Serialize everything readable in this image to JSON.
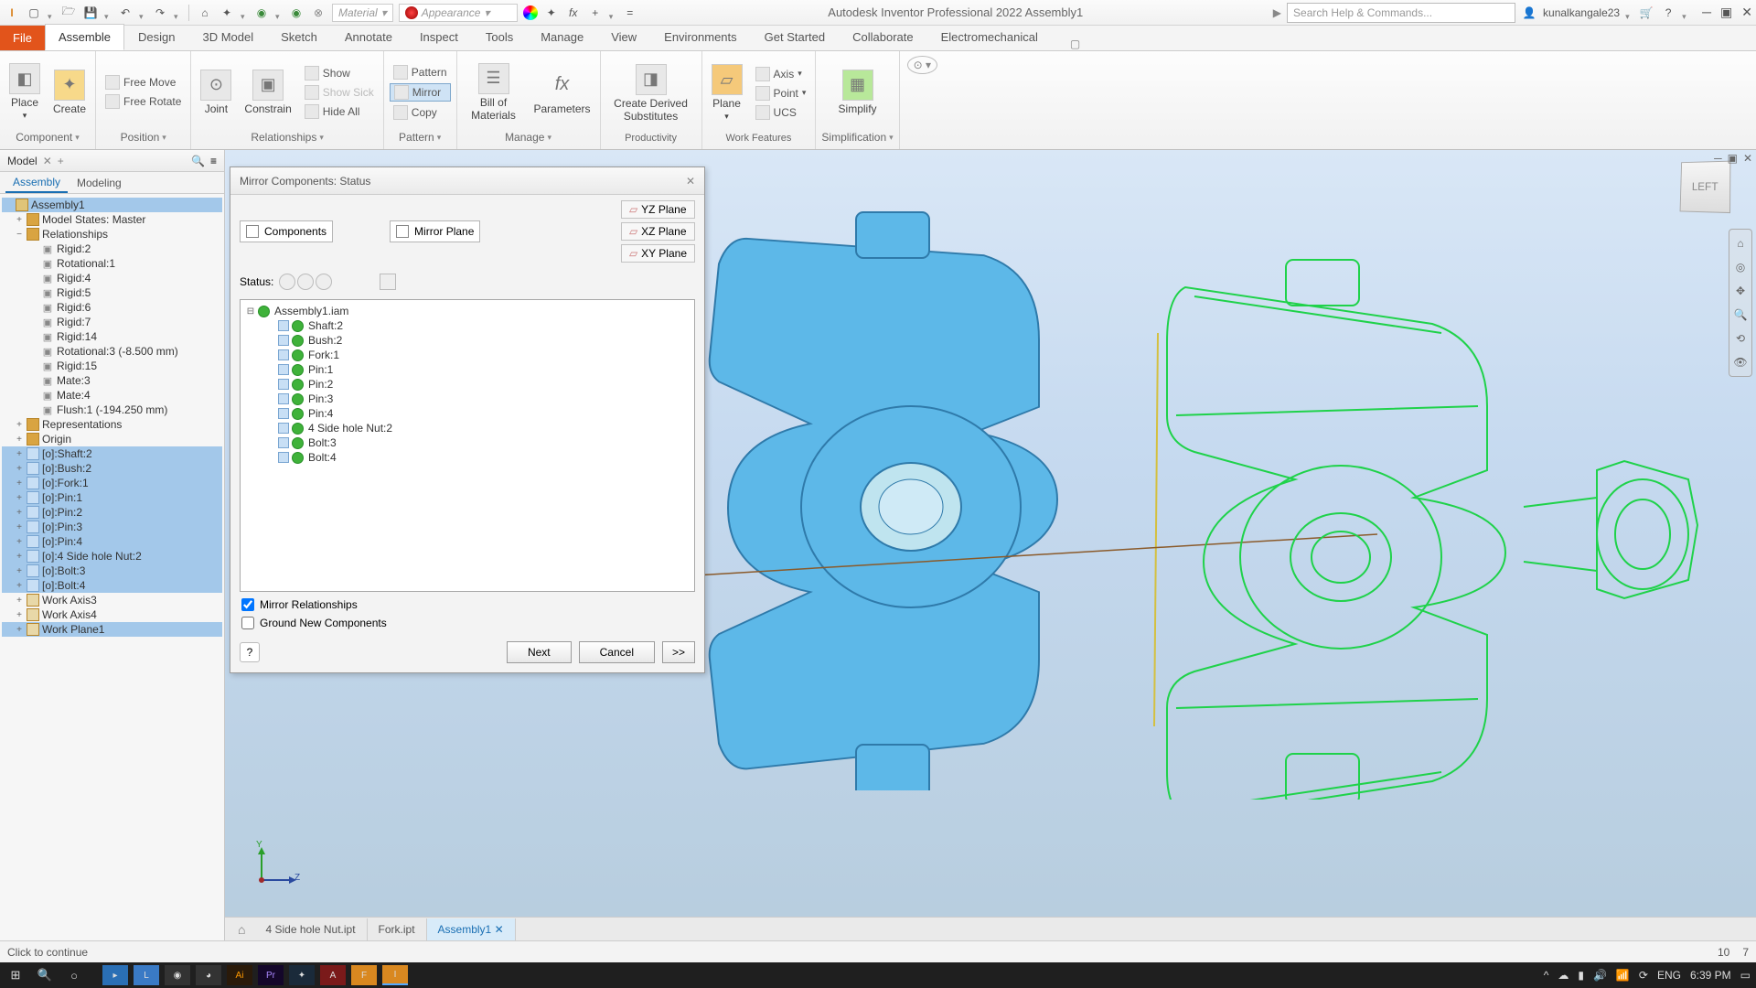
{
  "app": {
    "title": "Autodesk Inventor Professional 2022   Assembly1",
    "search_placeholder": "Search Help & Commands...",
    "user": "kunalkangale23"
  },
  "qat": {
    "material_label": "Material",
    "appearance_label": "Appearance"
  },
  "tabs": {
    "file": "File",
    "list": [
      "Assemble",
      "Design",
      "3D Model",
      "Sketch",
      "Annotate",
      "Inspect",
      "Tools",
      "Manage",
      "View",
      "Environments",
      "Get Started",
      "Collaborate",
      "Electromechanical"
    ],
    "active": "Assemble"
  },
  "ribbon": {
    "component": {
      "place": "Place",
      "create": "Create",
      "label": "Component"
    },
    "position": {
      "free_move": "Free Move",
      "free_rotate": "Free Rotate",
      "label": "Position"
    },
    "relationships": {
      "joint": "Joint",
      "constrain": "Constrain",
      "show": "Show",
      "show_sick": "Show Sick",
      "hide_all": "Hide All",
      "label": "Relationships"
    },
    "pattern": {
      "pattern": "Pattern",
      "mirror": "Mirror",
      "copy": "Copy",
      "label": "Pattern"
    },
    "manage": {
      "bom": "Bill of Materials",
      "params": "Parameters",
      "label": "Manage"
    },
    "productivity": {
      "cds": "Create Derived Substitutes",
      "label": "Productivity"
    },
    "plane": {
      "plane": "Plane",
      "axis": "Axis",
      "point": "Point",
      "ucs": "UCS",
      "label": "Work Features"
    },
    "simplification": {
      "simplify": "Simplify",
      "label": "Simplification"
    }
  },
  "browser": {
    "panel_name": "Model",
    "subtabs": [
      "Assembly",
      "Modeling"
    ],
    "root": "Assembly1",
    "model_states": "Model States: Master",
    "relationships": "Relationships",
    "constraints": [
      "Rigid:2",
      "Rotational:1",
      "Rigid:4",
      "Rigid:5",
      "Rigid:6",
      "Rigid:7",
      "Rigid:14",
      "Rotational:3 (-8.500 mm)",
      "Rigid:15",
      "Mate:3",
      "Mate:4",
      "Flush:1 (-194.250 mm)"
    ],
    "folders": [
      "Representations",
      "Origin"
    ],
    "parts": [
      "[o]:Shaft:2",
      "[o]:Bush:2",
      "[o]:Fork:1",
      "[o]:Pin:1",
      "[o]:Pin:2",
      "[o]:Pin:3",
      "[o]:Pin:4",
      "[o]:4 Side hole Nut:2",
      "[o]:Bolt:3",
      "[o]:Bolt:4"
    ],
    "work": [
      "Work Axis3",
      "Work Axis4",
      "Work Plane1"
    ]
  },
  "dialog": {
    "title": "Mirror Components: Status",
    "components": "Components",
    "mirror_plane": "Mirror Plane",
    "planes": [
      "YZ Plane",
      "XZ Plane",
      "XY Plane"
    ],
    "status_label": "Status:",
    "tree_root": "Assembly1.iam",
    "tree_items": [
      "Shaft:2",
      "Bush:2",
      "Fork:1",
      "Pin:1",
      "Pin:2",
      "Pin:3",
      "Pin:4",
      "4 Side hole Nut:2",
      "Bolt:3",
      "Bolt:4"
    ],
    "mirror_rel": "Mirror Relationships",
    "ground_new": "Ground New Components",
    "next": "Next",
    "cancel": "Cancel",
    "more": ">>"
  },
  "canvas": {
    "cube_face": "LEFT",
    "tabs": [
      "4 Side hole Nut.ipt",
      "Fork.ipt",
      "Assembly1"
    ],
    "active_tab": "Assembly1"
  },
  "status": {
    "msg": "Click to continue",
    "num1": "10",
    "num2": "7"
  },
  "taskbar": {
    "lang": "ENG",
    "time": "6:39 PM"
  }
}
